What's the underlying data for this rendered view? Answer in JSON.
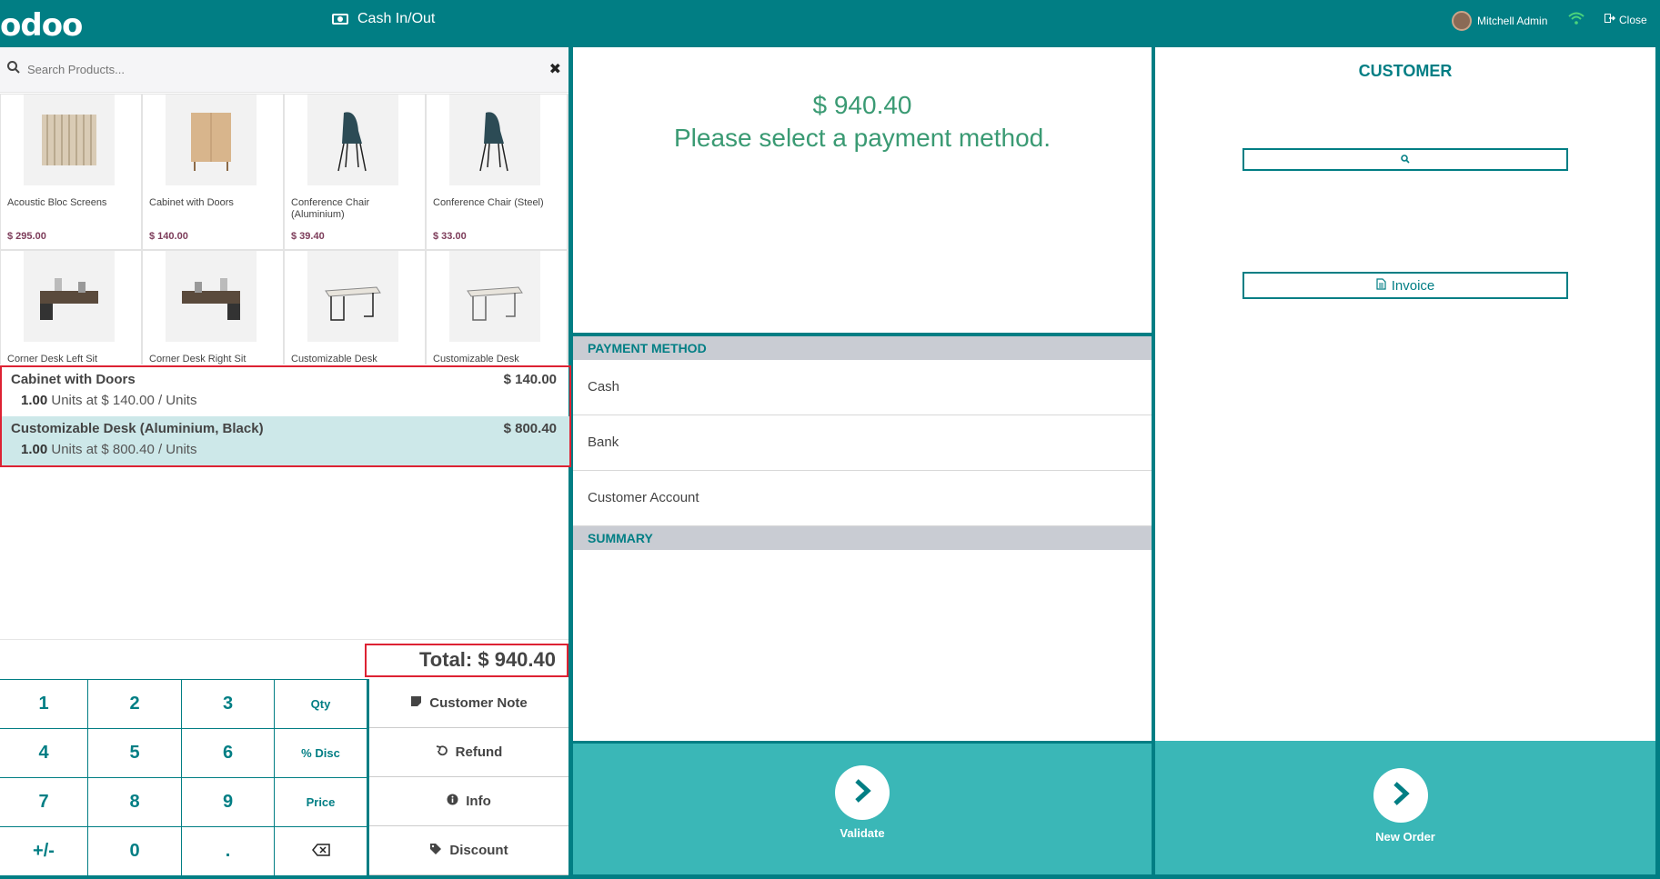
{
  "topbar": {
    "logo": "odoo",
    "cash_label": "Cash In/Out",
    "user_name": "Mitchell Admin",
    "close_label": "Close"
  },
  "search": {
    "placeholder": "Search Products..."
  },
  "products": [
    {
      "name": "Acoustic Bloc Screens",
      "price": "$ 295.00",
      "icon": "screens-image"
    },
    {
      "name": "Cabinet with Doors",
      "price": "$ 140.00",
      "icon": "cabinet-image"
    },
    {
      "name": "Conference Chair (Aluminium)",
      "price": "$ 39.40",
      "icon": "chair-image"
    },
    {
      "name": "Conference Chair (Steel)",
      "price": "$ 33.00",
      "icon": "chair-image"
    },
    {
      "name": "Corner Desk Left Sit",
      "price": "",
      "icon": "desk-image"
    },
    {
      "name": "Corner Desk Right Sit",
      "price": "",
      "icon": "desk-image"
    },
    {
      "name": "Customizable Desk",
      "price": "",
      "icon": "table-image"
    },
    {
      "name": "Customizable Desk",
      "price": "",
      "icon": "table-image"
    }
  ],
  "orderlines": [
    {
      "name": "Cabinet with Doors",
      "price": "$ 140.00",
      "qty": "1.00",
      "detail": "Units at $ 140.00 / Units"
    },
    {
      "name": "Customizable Desk (Aluminium, Black)",
      "price": "$ 800.40",
      "qty": "1.00",
      "detail": "Units at $ 800.40 / Units"
    }
  ],
  "total": "Total: $ 940.40",
  "numpad": {
    "keys": [
      "1",
      "2",
      "3",
      "Qty",
      "4",
      "5",
      "6",
      "% Disc",
      "7",
      "8",
      "9",
      "Price",
      "+/-",
      "0",
      "."
    ]
  },
  "controls": {
    "customer_note": "Customer Note",
    "refund": "Refund",
    "info": "Info",
    "discount": "Discount"
  },
  "payment": {
    "amount": "$ 940.40",
    "prompt": "Please select a payment method.",
    "method_header": "PAYMENT METHOD",
    "methods": [
      "Cash",
      "Bank",
      "Customer Account"
    ],
    "summary_header": "SUMMARY",
    "validate_label": "Validate"
  },
  "customer": {
    "title": "CUSTOMER",
    "invoice_label": "Invoice",
    "new_order_label": "New Order"
  }
}
